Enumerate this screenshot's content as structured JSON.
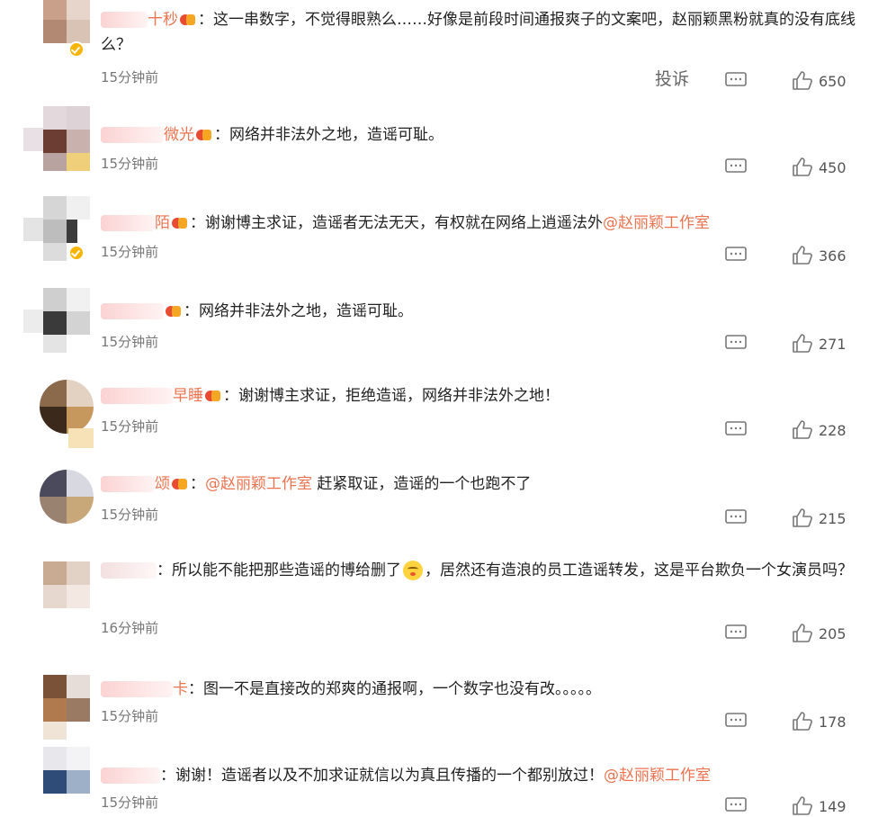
{
  "comments": [
    {
      "name_suffix": "十秒",
      "text": "：这一串数字，不觉得眼熟么……好像是前段时间通报爽子的文案吧，赵丽颖黑粉就真的没有底线么？",
      "time": "15分钟前",
      "report_label": "投诉",
      "likes": "650"
    },
    {
      "name_suffix": "微光",
      "text": "：网络并非法外之地，造谣可耻。",
      "time": "15分钟前",
      "likes": "450"
    },
    {
      "name_suffix": "陌",
      "text_before": "：谢谢博主求证，造谣者无法无天，有权就在网络上逍遥法外",
      "mention": "@赵丽颖工作室",
      "time": "15分钟前",
      "likes": "366"
    },
    {
      "name_suffix": "",
      "text": "：网络并非法外之地，造谣可耻。",
      "time": "15分钟前",
      "likes": "271"
    },
    {
      "name_suffix": "早睡",
      "text": "：谢谢博主求证，拒绝造谣，网络并非法外之地！",
      "time": "15分钟前",
      "likes": "228"
    },
    {
      "name_suffix": "颂",
      "text_before": "：",
      "mention": "@赵丽颖工作室",
      "text_after": " 赶紧取证，造谣的一个也跑不了",
      "time": "15分钟前",
      "likes": "215"
    },
    {
      "name_suffix": "",
      "text_before": "：所以能不能把那些造谣的博给删了",
      "text_after": "，居然还有造浪的员工造谣转发，这是平台欺负一个女演员吗？",
      "time": "16分钟前",
      "likes": "205"
    },
    {
      "name_suffix": "卡",
      "text": "：图一不是直接改的郑爽的通报啊，一个数字也没有改。。。。。",
      "time": "15分钟前",
      "likes": "178"
    },
    {
      "name_suffix": "",
      "text_before": "：谢谢！造谣者以及不加求证就信以为真且传播的一个都别放过！",
      "mention": "@赵丽颖工作室",
      "time": "15分钟前",
      "likes": "149"
    }
  ],
  "colors": {
    "accent": "#eb7350",
    "text": "#222222",
    "meta": "#777777",
    "vip_badge": "#f7b500"
  },
  "icons": {
    "reply": "comment-bubble-icon",
    "like": "thumbs-up-icon",
    "emoji": "smirk-emoji-icon",
    "verified": "verified-badge-icon"
  }
}
